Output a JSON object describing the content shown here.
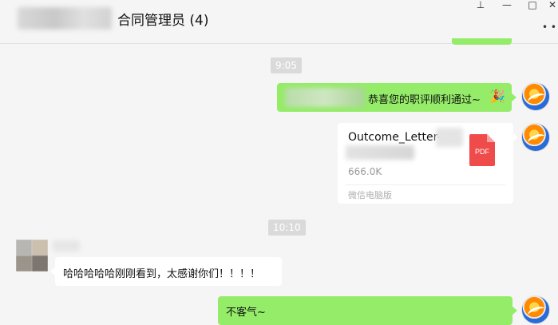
{
  "window": {
    "title": "合同管理员 (4)",
    "pin_icon": "⊥",
    "min_icon": "—",
    "max_icon": "□",
    "close_icon": "✕",
    "more_icon": "• •"
  },
  "messages": {
    "time_1": "9:05",
    "congrats_text": "恭喜您的职评顺利通过~",
    "congrats_emoji": "🎉",
    "file": {
      "name": "Outcome_Letter-",
      "size": "666.0K",
      "source": "微信电脑版",
      "badge": "PDF"
    },
    "time_2": "10:10",
    "reply_text": "哈哈哈哈哈刚刚看到，太感谢你们！！！！",
    "last_text": "不客气~"
  },
  "colors": {
    "green_bubble": "#95ec69",
    "pdf_red": "#f04b4b",
    "background": "#f5f5f5"
  }
}
